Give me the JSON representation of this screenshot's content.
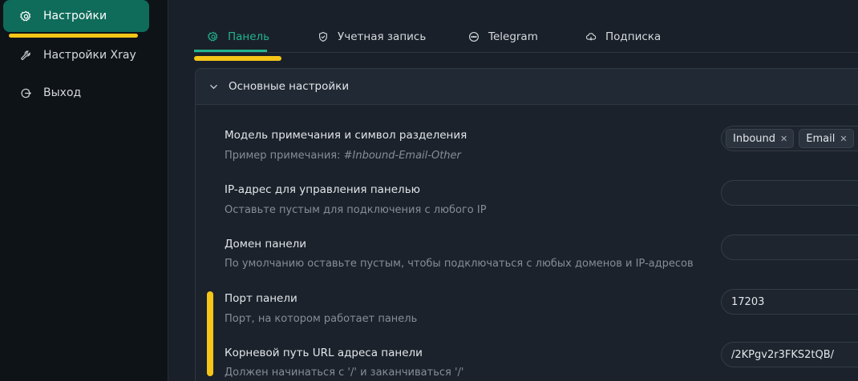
{
  "sidebar": {
    "items": [
      {
        "label": "Настройки",
        "icon": "gear-icon",
        "active": true
      },
      {
        "label": "Настройки Xray",
        "icon": "wrench-icon"
      },
      {
        "label": "Выход",
        "icon": "logout-icon"
      }
    ]
  },
  "tabs": [
    {
      "label": "Панель",
      "icon": "gear-icon",
      "active": true
    },
    {
      "label": "Учетная запись",
      "icon": "shield-icon"
    },
    {
      "label": "Telegram",
      "icon": "chat-icon"
    },
    {
      "label": "Подписка",
      "icon": "cloud-icon"
    }
  ],
  "section": {
    "title": "Основные настройки"
  },
  "settings": [
    {
      "title": "Модель примечания и символ разделения",
      "desc_prefix": "Пример примечания: ",
      "desc_example": "#Inbound-Email-Other",
      "tags": [
        "Inbound",
        "Email"
      ]
    },
    {
      "title": "IP-адрес для управления панелью",
      "desc": "Оставьте пустым для подключения с любого IP",
      "value": ""
    },
    {
      "title": "Домен панели",
      "desc": "По умолчанию оставьте пустым, чтобы подключаться с любых доменов и IP-адресов",
      "value": ""
    },
    {
      "title": "Порт панели",
      "desc": "Порт, на котором работает панель",
      "value": "17203"
    },
    {
      "title": "Корневой путь URL адреса панели",
      "desc": "Должен начинаться с '/' и заканчиваться '/'",
      "value": "/2KPgv2r3FKS2tQB/"
    }
  ],
  "colors": {
    "accent": "#21b38e",
    "active_bg": "#0f6b5a",
    "highlight": "#f5c518"
  }
}
